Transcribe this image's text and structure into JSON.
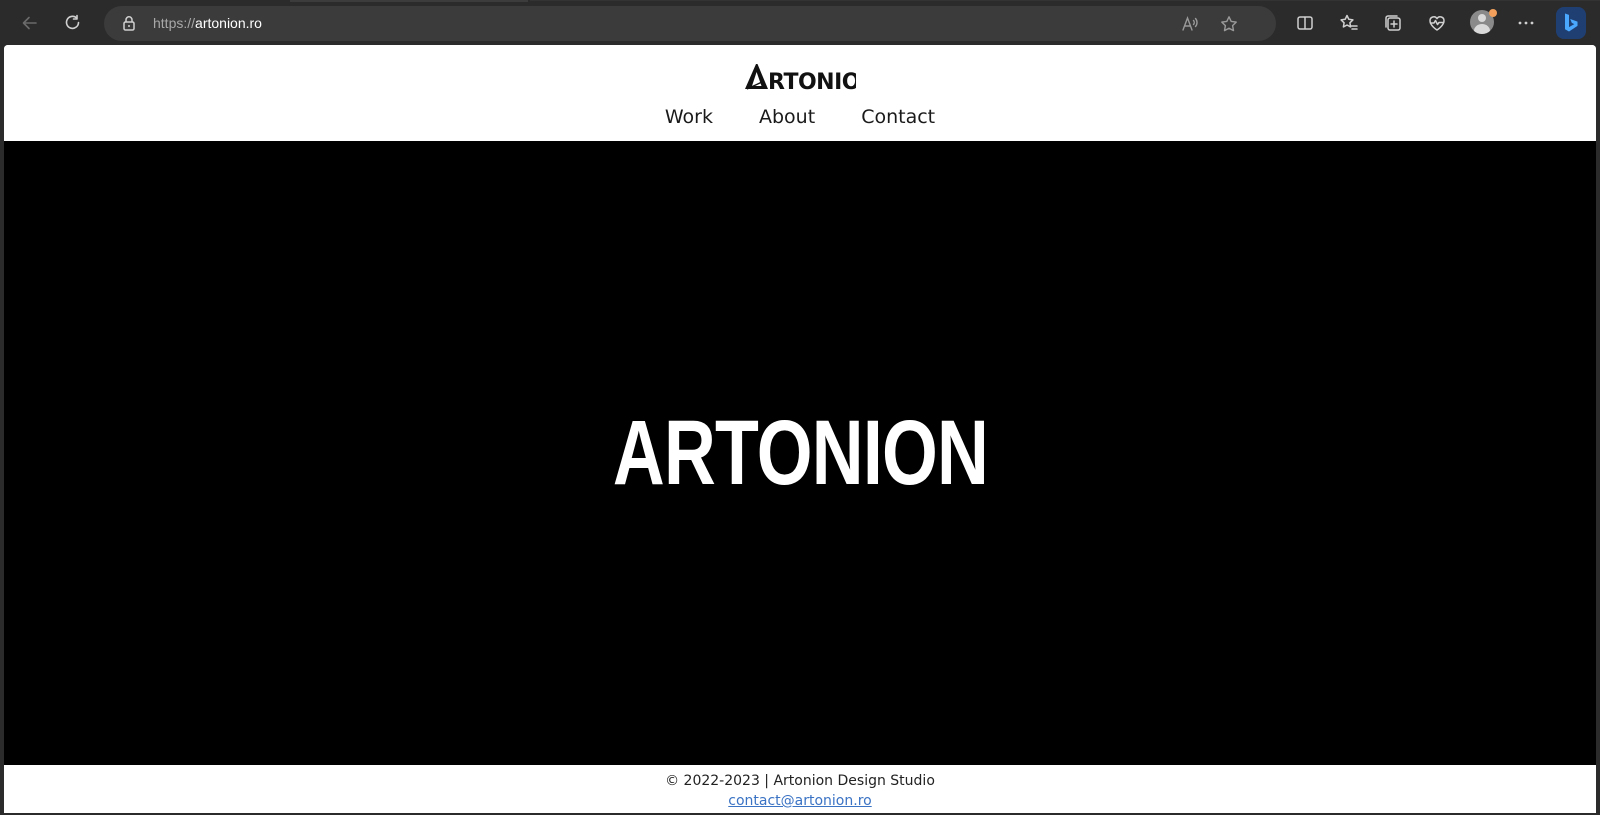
{
  "browser": {
    "url_protocol": "https://",
    "url_host": "artonion.ro",
    "icons": {
      "back": "back-arrow-icon",
      "refresh": "refresh-icon",
      "lock": "lock-icon",
      "read_aloud": "read-aloud-icon",
      "favorite": "star-icon",
      "split_screen": "split-screen-icon",
      "favorites": "favorites-list-icon",
      "collections": "collections-icon",
      "performance": "heart-pulse-icon",
      "profile": "profile-avatar-icon",
      "more": "more-dots-icon",
      "copilot": "bing-copilot-icon"
    }
  },
  "site": {
    "logo_text": "ARTONION",
    "nav": [
      {
        "label": "Work"
      },
      {
        "label": "About"
      },
      {
        "label": "Contact"
      }
    ],
    "hero_title": "ARTONION",
    "footer": {
      "copyright": "© 2022-2023 | Artonion Design Studio",
      "email": "contact@artonion.ro"
    }
  },
  "colors": {
    "chrome_bg": "#2b2b2b",
    "addressbar_bg": "#3b3b3b",
    "hero_bg": "#000000",
    "hero_text": "#ffffff",
    "link": "#3b73c4"
  }
}
